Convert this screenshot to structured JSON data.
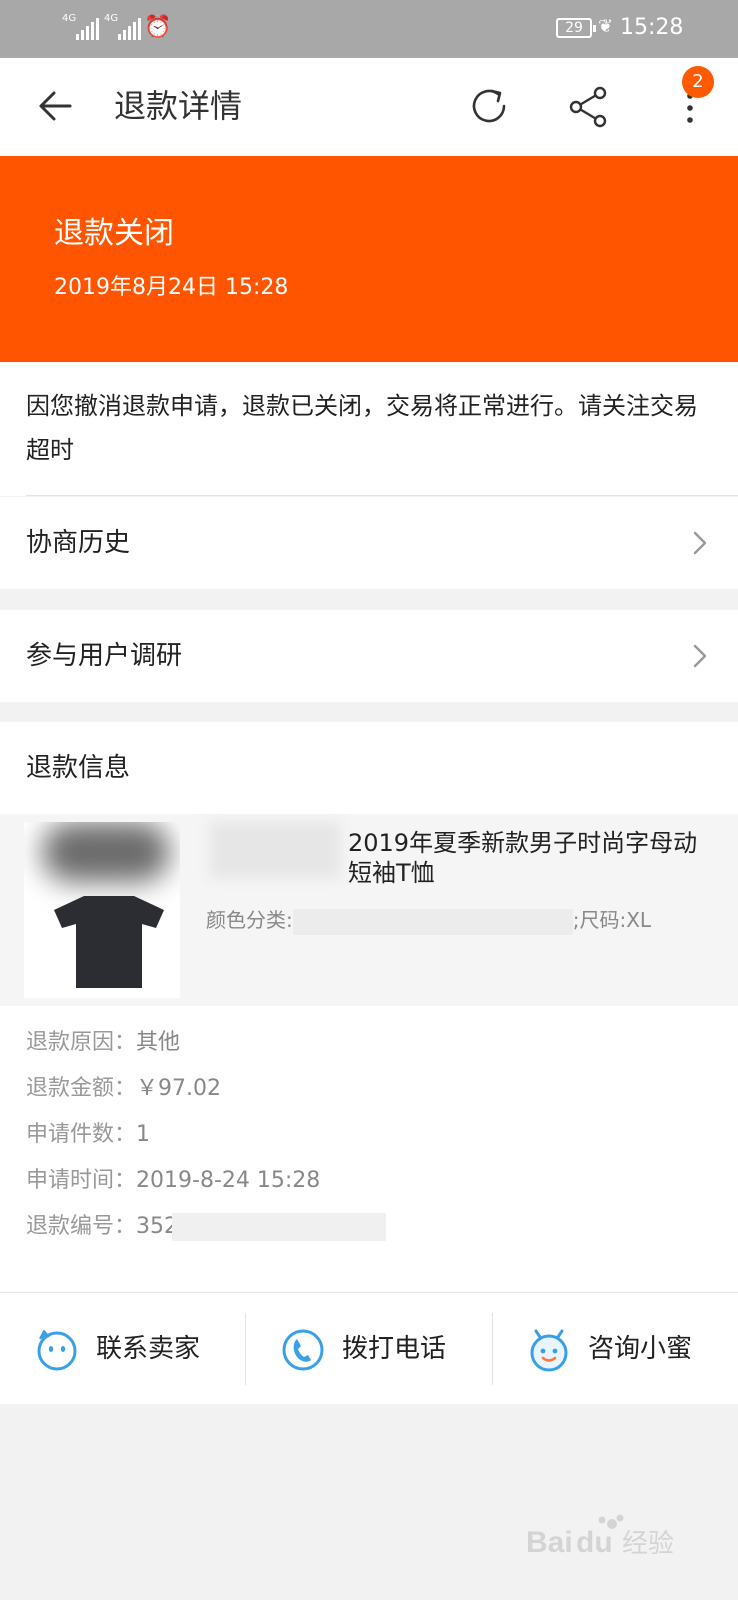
{
  "status_bar": {
    "signal_1": "4G",
    "signal_2": "4G",
    "battery": "29",
    "time": "15:28"
  },
  "header": {
    "title": "退款详情",
    "badge_count": "2",
    "icons": [
      "back-arrow-icon",
      "refresh-icon",
      "share-icon",
      "more-icon"
    ]
  },
  "banner": {
    "status": "退款关闭",
    "time": "2019年8月24日 15:28",
    "color": "#ff5500"
  },
  "notice": {
    "text": "因您撤消退款申请，退款已关闭，交易将正常进行。请关注交易超时"
  },
  "rows": {
    "history": "协商历史",
    "survey": "参与用户调研"
  },
  "refund_info": {
    "title": "退款信息",
    "product_name": "2019年夏季新款男子时尚字母动短袖T恤",
    "sku_prefix": "颜色分类:",
    "sku_suffix": ";尺码:XL",
    "reason_label": "退款原因：",
    "reason": "其他",
    "amount_label": "退款金额：",
    "amount": "￥97.02",
    "count_label": "申请件数：",
    "count": "1",
    "time_label": "申请时间：",
    "time": "2019-8-24 15:28",
    "id_label": "退款编号：",
    "id_visible": "352"
  },
  "actions": {
    "contact_seller": "联系卖家",
    "call": "拨打电话",
    "ask_assistant": "咨询小蜜"
  },
  "colors": {
    "accent": "#ff5500",
    "icon_blue": "#3aa0e6"
  }
}
